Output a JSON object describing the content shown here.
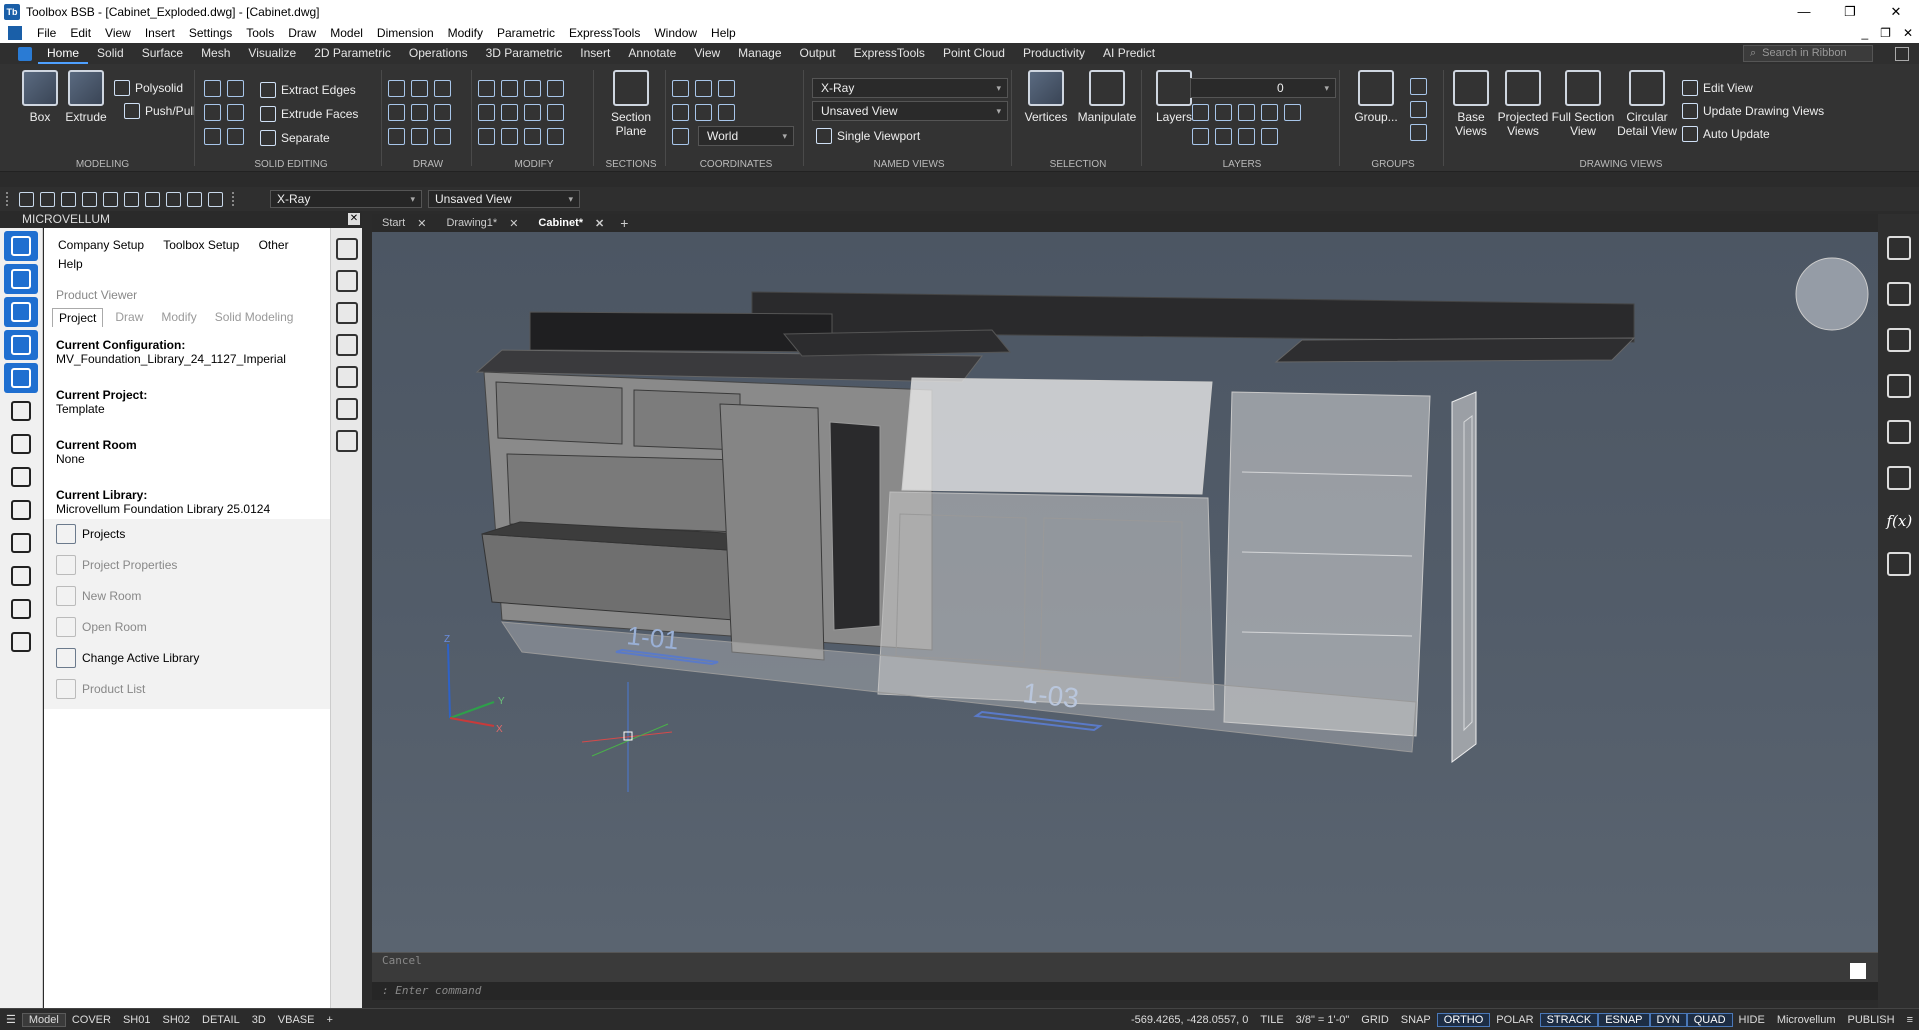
{
  "window": {
    "app_icon": "Tb",
    "title": "Toolbox BSB - [Cabinet_Exploded.dwg] - [Cabinet.dwg]",
    "controls": [
      "minimize-icon",
      "maximize-icon",
      "close-icon"
    ],
    "control_glyphs": [
      "—",
      "❐",
      "✕"
    ]
  },
  "menubar": {
    "items": [
      "File",
      "Edit",
      "View",
      "Insert",
      "Settings",
      "Tools",
      "Draw",
      "Model",
      "Dimension",
      "Modify",
      "Parametric",
      "ExpressTools",
      "Window",
      "Help"
    ],
    "right_glyphs": [
      "_",
      "❐",
      "✕"
    ]
  },
  "ribbon_tabs": {
    "items": [
      "Home",
      "Solid",
      "Surface",
      "Mesh",
      "Visualize",
      "2D Parametric",
      "Operations",
      "3D Parametric",
      "Insert",
      "Annotate",
      "View",
      "Manage",
      "Output",
      "ExpressTools",
      "Point Cloud",
      "Productivity",
      "AI Predict"
    ],
    "active": "Home",
    "search_placeholder": "Search in Ribbon"
  },
  "ribbon": {
    "modeling": {
      "label": "MODELING",
      "box": "Box",
      "extrude": "Extrude",
      "polysolid": "Polysolid",
      "pushpull": "Push/Pull"
    },
    "solid_editing": {
      "label": "SOLID EDITING",
      "extract_edges": "Extract Edges",
      "extrude_faces": "Extrude Faces",
      "separate": "Separate"
    },
    "draw": {
      "label": "DRAW"
    },
    "modify": {
      "label": "MODIFY"
    },
    "sections": {
      "label": "SECTIONS",
      "section_plane": "Section Plane"
    },
    "coordinates": {
      "label": "COORDINATES",
      "world": "World"
    },
    "named_views": {
      "label": "NAMED VIEWS",
      "visual_style": "X-Ray",
      "view": "Unsaved View",
      "viewport": "Single Viewport"
    },
    "selection": {
      "label": "SELECTION",
      "vertices": "Vertices",
      "manipulate": "Manipulate"
    },
    "layers": {
      "label": "LAYERS",
      "layers": "Layers",
      "current_layer": "0"
    },
    "groups": {
      "label": "GROUPS",
      "group": "Group..."
    },
    "drawing_views": {
      "label": "DRAWING VIEWS",
      "base_views": "Base Views",
      "projected_views": "Projected Views",
      "full_section": "Full Section View",
      "circular_detail": "Circular Detail View",
      "edit_view": "Edit View",
      "update_drawing_views": "Update Drawing Views",
      "auto_update": "Auto Update"
    }
  },
  "qat": {
    "visual_style": "X-Ray",
    "view": "Unsaved View"
  },
  "microvellum": {
    "panel_title": "MICROVELLUM",
    "top_menu": [
      "Company Setup",
      "Toolbox Setup",
      "Other",
      "Help"
    ],
    "product_viewer": "Product Viewer",
    "tabs": [
      "Project",
      "Draw",
      "Modify",
      "Solid Modeling"
    ],
    "active_tab": "Project",
    "info": [
      {
        "key": "Current Configuration:",
        "value": "MV_Foundation_Library_24_1127_Imperial"
      },
      {
        "key": "Current Project:",
        "value": "Template"
      },
      {
        "key": "Current Room",
        "value": "None"
      },
      {
        "key": "Current Library:",
        "value": "Microvellum Foundation Library 25.0124"
      }
    ],
    "actions": [
      {
        "label": "Projects",
        "enabled": true
      },
      {
        "label": "Project Properties",
        "enabled": false
      },
      {
        "label": "New Room",
        "enabled": false
      },
      {
        "label": "Open Room",
        "enabled": false
      },
      {
        "label": "Change Active Library",
        "enabled": true
      },
      {
        "label": "Product List",
        "enabled": false
      }
    ]
  },
  "doc_tabs": {
    "items": [
      "Start",
      "Drawing1*",
      "Cabinet*"
    ],
    "active": "Cabinet*"
  },
  "viewport": {
    "labels": [
      "1-01",
      "1-03"
    ],
    "ucs": {
      "x": "X",
      "y": "Y",
      "z": "Z"
    }
  },
  "command": {
    "history": "Cancel",
    "prompt": ": Enter command"
  },
  "statusbar": {
    "model": "Model",
    "layouts": [
      "COVER",
      "SH01",
      "SH02",
      "DETAIL",
      "3D",
      "VBASE"
    ],
    "coords": "-569.4265, -428.0557, 0",
    "tile": "TILE",
    "scale": "3/8\" = 1'-0\"",
    "grid": "GRID",
    "snap": "SNAP",
    "ortho": "ORTHO",
    "polar": "POLAR",
    "strack": "STRACK",
    "esnap": "ESNAP",
    "dyn": "DYN",
    "quad": "QUAD",
    "hide": "HIDE",
    "workspace": "Microvellum",
    "publish": "PUBLISH"
  }
}
